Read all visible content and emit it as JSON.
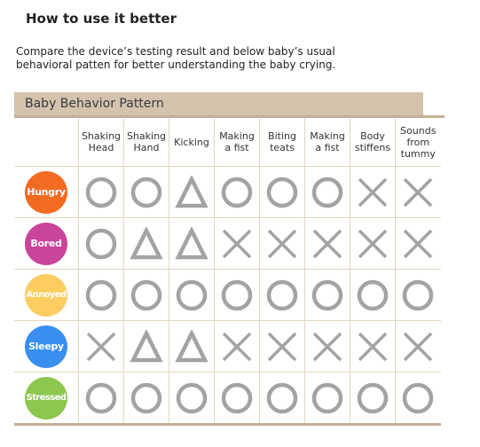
{
  "page": {
    "title": "How to use it better",
    "description": "Compare the device’s testing result and below baby’s usual behavioral patten for better understanding the baby crying."
  },
  "table": {
    "heading": "Baby Behavior Pattern",
    "columns": [
      [
        "Shaking",
        "Head"
      ],
      [
        "Shaking",
        "Hand"
      ],
      [
        "Kicking"
      ],
      [
        "Making",
        "a fist"
      ],
      [
        "Biting",
        "teats"
      ],
      [
        "Making",
        "a fist"
      ],
      [
        "Body",
        "stiffens"
      ],
      [
        "Sounds",
        "from",
        "tummy"
      ]
    ],
    "symbol_color": "#a3a3a3",
    "rows": [
      {
        "label": "Hungry",
        "color": "#f26b21",
        "values": [
          "circle",
          "circle",
          "triangle",
          "circle",
          "circle",
          "circle",
          "cross",
          "cross"
        ]
      },
      {
        "label": "Bored",
        "color": "#c9449b",
        "values": [
          "circle",
          "triangle",
          "triangle",
          "cross",
          "cross",
          "cross",
          "cross",
          "cross"
        ]
      },
      {
        "label": "Annoyed",
        "color": "#fdcd62",
        "values": [
          "circle",
          "circle",
          "circle",
          "circle",
          "circle",
          "circle",
          "circle",
          "circle"
        ]
      },
      {
        "label": "Sleepy",
        "color": "#3a8ef0",
        "values": [
          "cross",
          "triangle",
          "triangle",
          "cross",
          "cross",
          "cross",
          "cross",
          "cross"
        ]
      },
      {
        "label": "Stressed",
        "color": "#8cc74f",
        "values": [
          "circle",
          "circle",
          "circle",
          "circle",
          "circle",
          "circle",
          "circle",
          "circle"
        ]
      }
    ]
  }
}
